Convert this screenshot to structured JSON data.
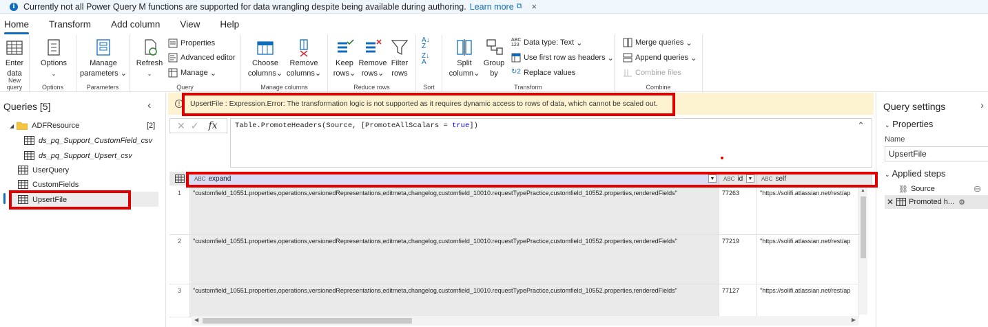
{
  "banner": {
    "message": "Currently not all Power Query M functions are supported for data wrangling despite being available during authoring.",
    "link": "Learn more",
    "close": "×"
  },
  "menu": {
    "tabs": [
      "Home",
      "Transform",
      "Add column",
      "View",
      "Help"
    ],
    "active": "Home"
  },
  "ribbon": {
    "new_query": {
      "label": "New query",
      "enter_data": [
        "Enter",
        "data"
      ]
    },
    "options": {
      "label": "Options",
      "button": "Options"
    },
    "parameters": {
      "label": "Parameters",
      "manage": [
        "Manage",
        "parameters"
      ]
    },
    "query": {
      "label": "Query",
      "refresh": "Refresh",
      "properties": "Properties",
      "advanced_editor": "Advanced editor",
      "manage": "Manage"
    },
    "manage_columns": {
      "label": "Manage columns",
      "choose": [
        "Choose",
        "columns"
      ],
      "remove": [
        "Remove",
        "columns"
      ]
    },
    "reduce_rows": {
      "label": "Reduce rows",
      "keep": [
        "Keep",
        "rows"
      ],
      "remove": [
        "Remove",
        "rows"
      ],
      "filter": [
        "Filter",
        "rows"
      ]
    },
    "sort": {
      "label": "Sort"
    },
    "transform": {
      "label": "Transform",
      "split": [
        "Split",
        "column"
      ],
      "group": [
        "Group",
        "by"
      ],
      "data_type": "Data type: Text",
      "first_row": "Use first row as headers",
      "replace": "Replace values"
    },
    "combine": {
      "label": "Combine",
      "merge": "Merge queries",
      "append": "Append queries",
      "combine_files": "Combine files"
    }
  },
  "queries": {
    "title": "Queries [5]",
    "folder": {
      "name": "ADFResource",
      "count": "[2]"
    },
    "folder_items": [
      "ds_pq_Support_CustomField_csv",
      "ds_pq_Support_Upsert_csv"
    ],
    "items": [
      "UserQuery",
      "CustomFields",
      "UpsertFile"
    ]
  },
  "error": {
    "text": "UpsertFile : Expression.Error: The transformation logic is not supported as it requires dynamic access to rows of data, which cannot be scaled out."
  },
  "formula": {
    "prefix": "Table.PromoteHeaders(Source, [PromoteAllScalars = ",
    "keyword": "true",
    "suffix": "])"
  },
  "grid": {
    "columns": [
      {
        "type": "ABC",
        "name": "expand"
      },
      {
        "type": "ABC",
        "name": "id"
      },
      {
        "type": "ABC",
        "name": "self"
      }
    ],
    "rows": [
      {
        "num": "1",
        "expand": "\"customfield_10551.properties,operations,versionedRepresentations,editmeta,changelog,customfield_10010.requestTypePractice,customfield_10552.properties,renderedFields\"",
        "id": "77263",
        "self": "\"https://solifi.atlassian.net/rest/ap"
      },
      {
        "num": "2",
        "expand": "\"customfield_10551.properties,operations,versionedRepresentations,editmeta,changelog,customfield_10010.requestTypePractice,customfield_10552.properties,renderedFields\"",
        "id": "77219",
        "self": "\"https://solifi.atlassian.net/rest/ap"
      },
      {
        "num": "3",
        "expand": "\"customfield_10551.properties,operations,versionedRepresentations,editmeta,changelog,customfield_10010.requestTypePractice,customfield_10552.properties,renderedFields\"",
        "id": "77127",
        "self": "\"https://solifi.atlassian.net/rest/ap"
      }
    ]
  },
  "settings": {
    "title": "Query settings",
    "properties": "Properties",
    "name_label": "Name",
    "name_value": "UpsertFile",
    "applied_steps": "Applied steps",
    "steps": [
      "Source",
      "Promoted h..."
    ]
  },
  "colors": {
    "accent": "#0f6cbd",
    "highlight": "#e00000",
    "error_bg": "#fdf3d0"
  }
}
